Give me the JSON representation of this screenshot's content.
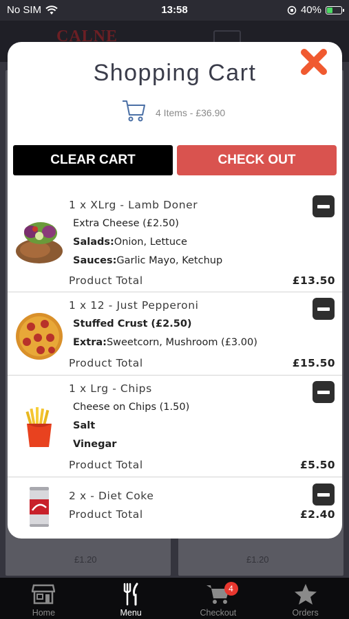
{
  "status_bar": {
    "carrier": "No SIM",
    "time": "13:58",
    "battery": "40%",
    "battery_level": 0.4
  },
  "background": {
    "logo": "CALNE",
    "prices": [
      "£1.20",
      "£1.20"
    ]
  },
  "cart": {
    "title": "Shopping Cart",
    "summary": "4 Items - £36.90",
    "clear_label": "CLEAR CART",
    "checkout_label": "CHECK OUT",
    "items": [
      {
        "name": "1 x XLrg - Lamb Doner",
        "image_icon": "doner-kebab-image",
        "options": [
          {
            "label": "",
            "text": "Extra Cheese (£2.50)"
          },
          {
            "label": "Salads:",
            "text": "Onion, Lettuce"
          },
          {
            "label": "Sauces:",
            "text": "Garlic Mayo, Ketchup"
          }
        ],
        "total_label": "Product Total",
        "total": "£13.50"
      },
      {
        "name": "1 x 12 - Just Pepperoni",
        "image_icon": "pepperoni-pizza-image",
        "options": [
          {
            "label": "Stuffed Crust (£2.50)",
            "text": ""
          },
          {
            "label": "Extra:",
            "text": "Sweetcorn, Mushroom (£3.00)"
          }
        ],
        "total_label": "Product Total",
        "total": "£15.50"
      },
      {
        "name": "1 x Lrg - Chips",
        "image_icon": "chips-image",
        "options": [
          {
            "label": "",
            "text": "Cheese on Chips (1.50)"
          },
          {
            "label": "Salt",
            "text": ""
          },
          {
            "label": "Vinegar",
            "text": ""
          }
        ],
        "total_label": "Product Total",
        "total": "£5.50"
      },
      {
        "name": "2 x - Diet Coke",
        "image_icon": "diet-coke-can-image",
        "options": [],
        "total_label": "Product Total",
        "total": "£2.40"
      }
    ]
  },
  "nav": [
    {
      "label": "Home",
      "icon": "store-icon"
    },
    {
      "label": "Menu",
      "icon": "fork-knife-icon",
      "active": true
    },
    {
      "label": "Checkout",
      "icon": "cart-icon",
      "badge": "4"
    },
    {
      "label": "Orders",
      "icon": "star-icon"
    }
  ],
  "colors": {
    "accent": "#d9534f",
    "close": "#f05a30",
    "badge": "#e8372f"
  }
}
